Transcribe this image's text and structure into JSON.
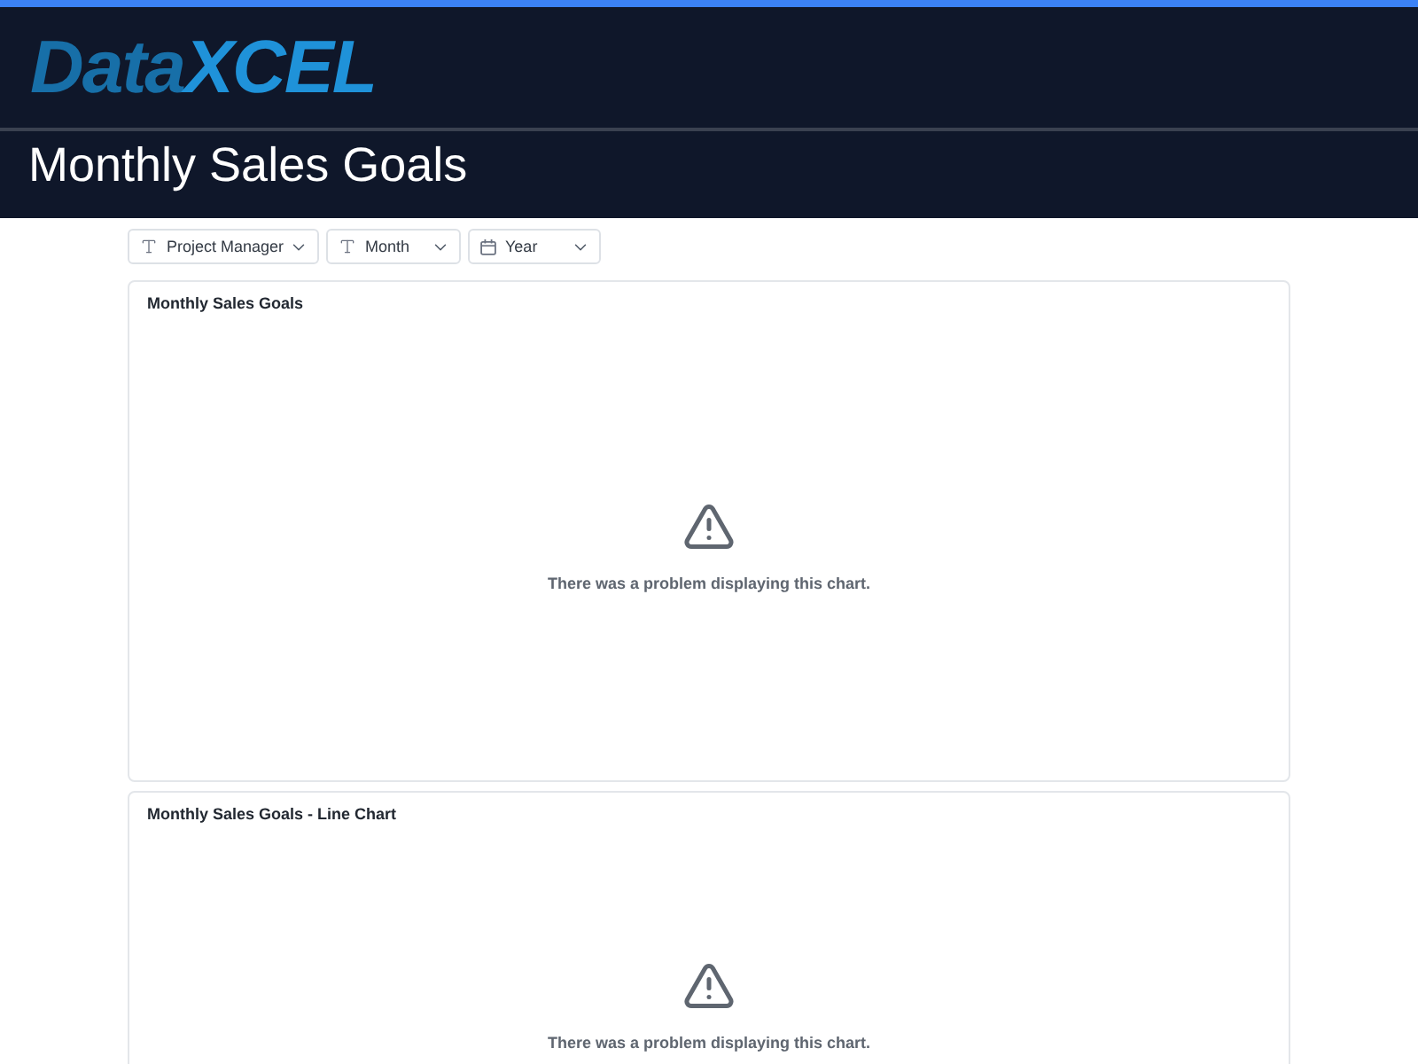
{
  "header": {
    "logo": {
      "lead": "Data",
      "accent": "XCEL"
    },
    "title": "Monthly Sales Goals"
  },
  "filters": [
    {
      "kind": "text",
      "label": "Project Manager"
    },
    {
      "kind": "text",
      "label": "Month"
    },
    {
      "kind": "date",
      "label": "Year"
    }
  ],
  "charts": [
    {
      "kind": "error",
      "title": "Monthly Sales Goals",
      "message": "There was a problem displaying this chart."
    },
    {
      "kind": "error",
      "title": "Monthly Sales Goals - Line Chart",
      "message": "There was a problem displaying this chart."
    }
  ]
}
